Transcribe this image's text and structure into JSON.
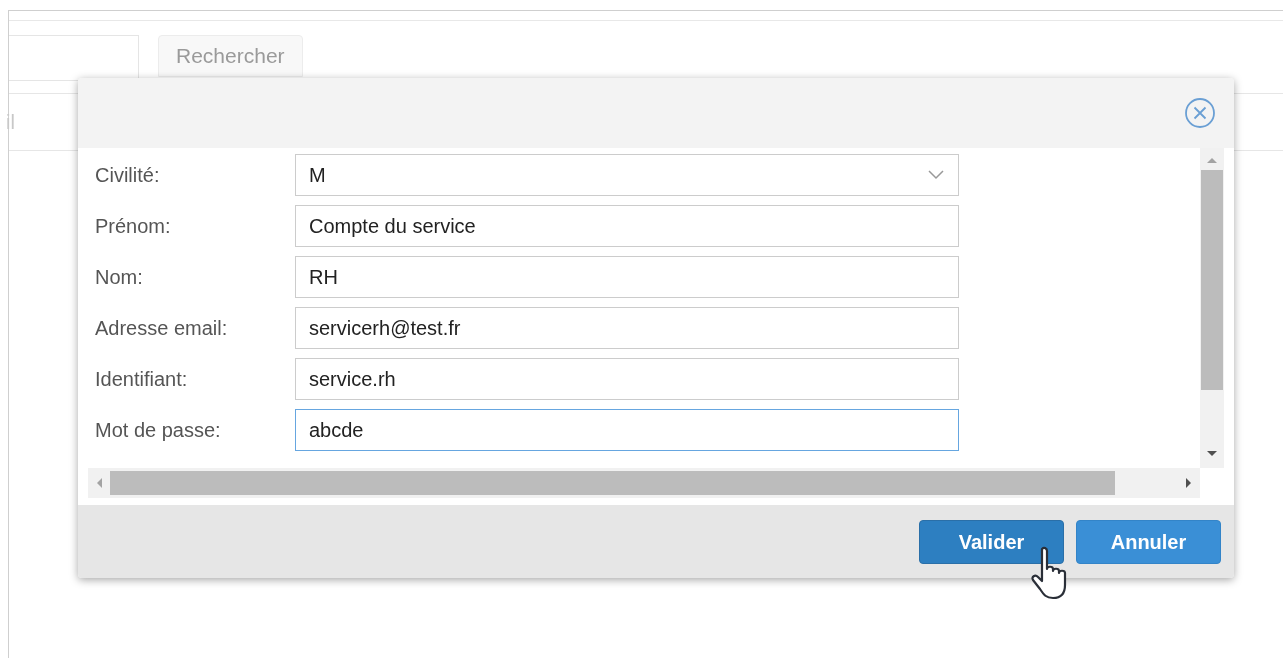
{
  "background": {
    "search_button": "Rechercher",
    "column_1": "il"
  },
  "dialog": {
    "fields": [
      {
        "kind": "select",
        "label": "Civilité:",
        "value": "M",
        "focused": false
      },
      {
        "kind": "text",
        "label": "Prénom:",
        "value": "Compte du service",
        "focused": false
      },
      {
        "kind": "text",
        "label": "Nom:",
        "value": "RH",
        "focused": false
      },
      {
        "kind": "text",
        "label": "Adresse email:",
        "value": "servicerh@test.fr",
        "focused": false
      },
      {
        "kind": "text",
        "label": "Identifiant:",
        "value": "service.rh",
        "focused": false
      },
      {
        "kind": "text",
        "label": "Mot de passe:",
        "value": "abcde",
        "focused": true
      }
    ],
    "buttons": [
      {
        "label": "Valider",
        "hovered": true
      },
      {
        "label": "Annuler",
        "hovered": false
      }
    ]
  }
}
